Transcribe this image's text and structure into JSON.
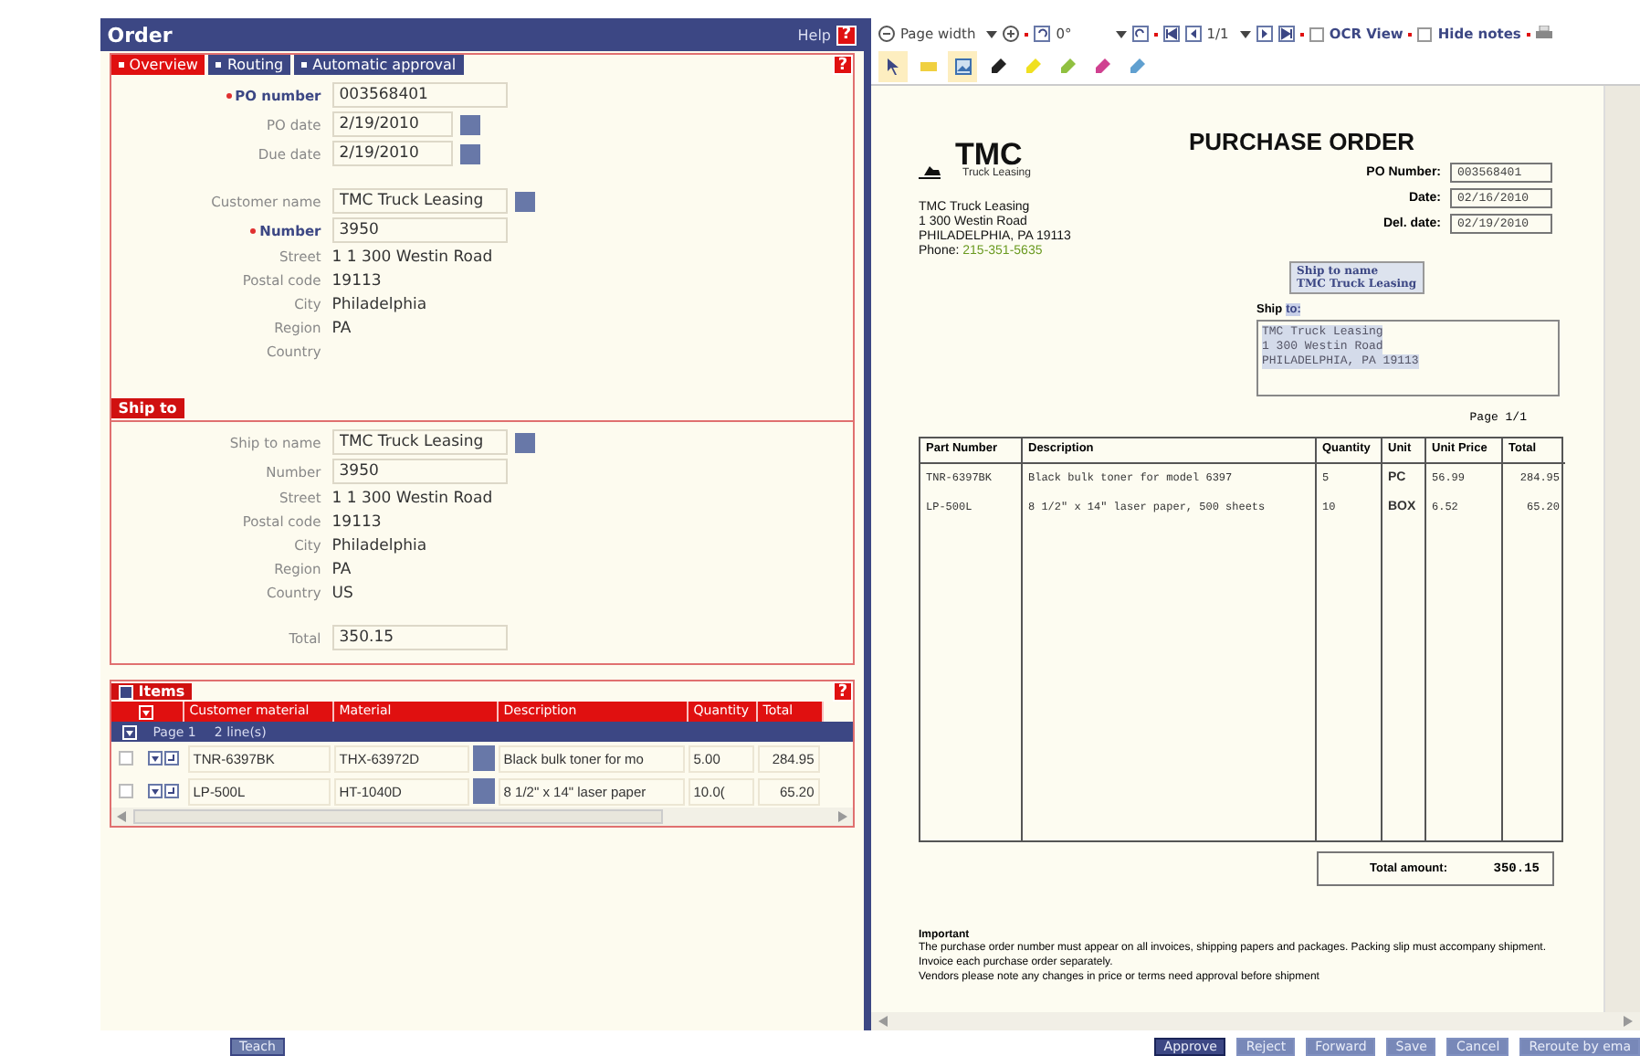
{
  "header": {
    "title": "Order",
    "help": "Help",
    "help_icon": "?"
  },
  "tabs": [
    {
      "label": "Overview",
      "selected": true
    },
    {
      "label": "Routing",
      "selected": false
    },
    {
      "label": "Automatic approval",
      "selected": false
    }
  ],
  "tab_help": "?",
  "order_fields": [
    {
      "kind": "input",
      "label": "PO number",
      "value": "003568401",
      "required": true
    },
    {
      "kind": "date",
      "label": "PO date",
      "value": "2/19/2010",
      "required": false
    },
    {
      "kind": "date",
      "label": "Due date",
      "value": "2/19/2010",
      "required": false
    },
    {
      "kind": "gap"
    },
    {
      "kind": "lookup",
      "label": "Customer name",
      "value": "TMC Truck Leasing",
      "required": false
    },
    {
      "kind": "input",
      "label": "Number",
      "value": "3950",
      "required": true
    },
    {
      "kind": "text",
      "label": "Street",
      "value": "1 1 300 Westin Road",
      "required": false
    },
    {
      "kind": "text",
      "label": "Postal code",
      "value": "19113",
      "required": false
    },
    {
      "kind": "text",
      "label": "City",
      "value": "Philadelphia",
      "required": false
    },
    {
      "kind": "text",
      "label": "Region",
      "value": "PA",
      "required": false
    },
    {
      "kind": "text",
      "label": "Country",
      "required": false
    }
  ],
  "ship_to": {
    "title": "Ship to",
    "fields": [
      {
        "kind": "lookup",
        "label": "Ship to name",
        "value": "TMC Truck Leasing",
        "required": false
      },
      {
        "kind": "input",
        "label": "Number",
        "value": "3950",
        "required": false
      },
      {
        "kind": "text",
        "label": "Street",
        "value": "1 1 300 Westin Road",
        "required": false
      },
      {
        "kind": "text",
        "label": "Postal code",
        "value": "19113",
        "required": false
      },
      {
        "kind": "text",
        "label": "City",
        "value": "Philadelphia",
        "required": false
      },
      {
        "kind": "text",
        "label": "Region",
        "value": "PA",
        "required": false
      },
      {
        "kind": "text",
        "label": "Country",
        "value": "US",
        "required": false
      },
      {
        "kind": "gap"
      },
      {
        "kind": "input",
        "label": "Total",
        "value": "350.15",
        "required": false
      }
    ]
  },
  "items": {
    "title": "Items",
    "help": "?",
    "columns": [
      "Customer material",
      "Material",
      "Description",
      "Quantity",
      "Total"
    ],
    "page": "Page 1",
    "lines": "2 line(s)",
    "rows": [
      {
        "checked": false,
        "customer_material": "TNR-6397BK",
        "material": "THX-63972D",
        "description": "Black bulk toner for mo",
        "quantity": "5.00",
        "total": "284.95"
      },
      {
        "checked": false,
        "customer_material": "LP-500L",
        "material": "HT-1040D",
        "description": "8 1/2\" x 14\" laser paper",
        "quantity": "10.0(",
        "total": "65.20"
      }
    ]
  },
  "viewer": {
    "zoom": "Page width",
    "rotation": "0°",
    "page": "1/1",
    "ocr_view": {
      "label": "OCR View",
      "checked": false
    },
    "hide_notes": {
      "label": "Hide notes",
      "checked": false
    },
    "tools": [
      {
        "kind": "pointer",
        "selected": true
      },
      {
        "kind": "note",
        "selected": false
      },
      {
        "kind": "image",
        "selected": true
      },
      {
        "kind": "marker",
        "selected": false,
        "color": "#222222"
      },
      {
        "kind": "marker",
        "selected": false,
        "color": "#f0e020"
      },
      {
        "kind": "marker",
        "selected": false,
        "color": "#90c040"
      },
      {
        "kind": "marker",
        "selected": false,
        "color": "#d04090"
      },
      {
        "kind": "marker",
        "selected": false,
        "color": "#60a0d0"
      }
    ]
  },
  "document": {
    "title": "PURCHASE ORDER",
    "logo": "TMC",
    "logo_sub": "Truck Leasing",
    "address": [
      "TMC Truck Leasing",
      "1 300 Westin Road",
      "PHILADELPHIA, PA 19113"
    ],
    "phone_label": "Phone:",
    "phone": "215-351-5635",
    "fields": [
      {
        "label": "PO Number:",
        "value": "003568401"
      },
      {
        "label": "Date:",
        "value": "02/16/2010"
      },
      {
        "label": "Del. date:",
        "value": "02/19/2010"
      }
    ],
    "tooltip": [
      "Ship to name",
      "TMC Truck Leasing"
    ],
    "ship_label": "Ship",
    "ship_label_marked": "to:",
    "ship_lines": [
      "TMC Truck Leasing",
      "1 300 Westin Road",
      "PHILADELPHIA, PA 19113"
    ],
    "page": "Page 1/1",
    "columns": [
      "Part Number",
      "Description",
      "Quantity",
      "Unit",
      "Unit Price",
      "Total"
    ],
    "rows": [
      [
        "TNR-6397BK",
        "Black bulk toner for model 6397",
        "5",
        "PC",
        "56.99",
        "284.95"
      ],
      [
        "LP-500L",
        "8 1/2\" x 14\" laser paper, 500 sheets",
        "10",
        "BOX",
        "6.52",
        "65.20"
      ]
    ],
    "total_label": "Total amount:",
    "total": "350.15",
    "notes_title": "Important",
    "notes": [
      "The purchase order number must appear on all invoices, shipping papers and packages. Packing slip must accompany shipment. Invoice each purchase order separately.",
      "Vendors please note any changes in price or terms need approval before shipment"
    ]
  },
  "footer": {
    "teach": "Teach",
    "buttons": [
      {
        "label": "Approve",
        "default": true
      },
      {
        "label": "Reject",
        "default": false
      },
      {
        "label": "Forward",
        "default": false
      },
      {
        "label": "Save",
        "default": false
      },
      {
        "label": "Cancel",
        "default": false
      },
      {
        "label": "Reroute by ema",
        "default": false
      }
    ]
  }
}
